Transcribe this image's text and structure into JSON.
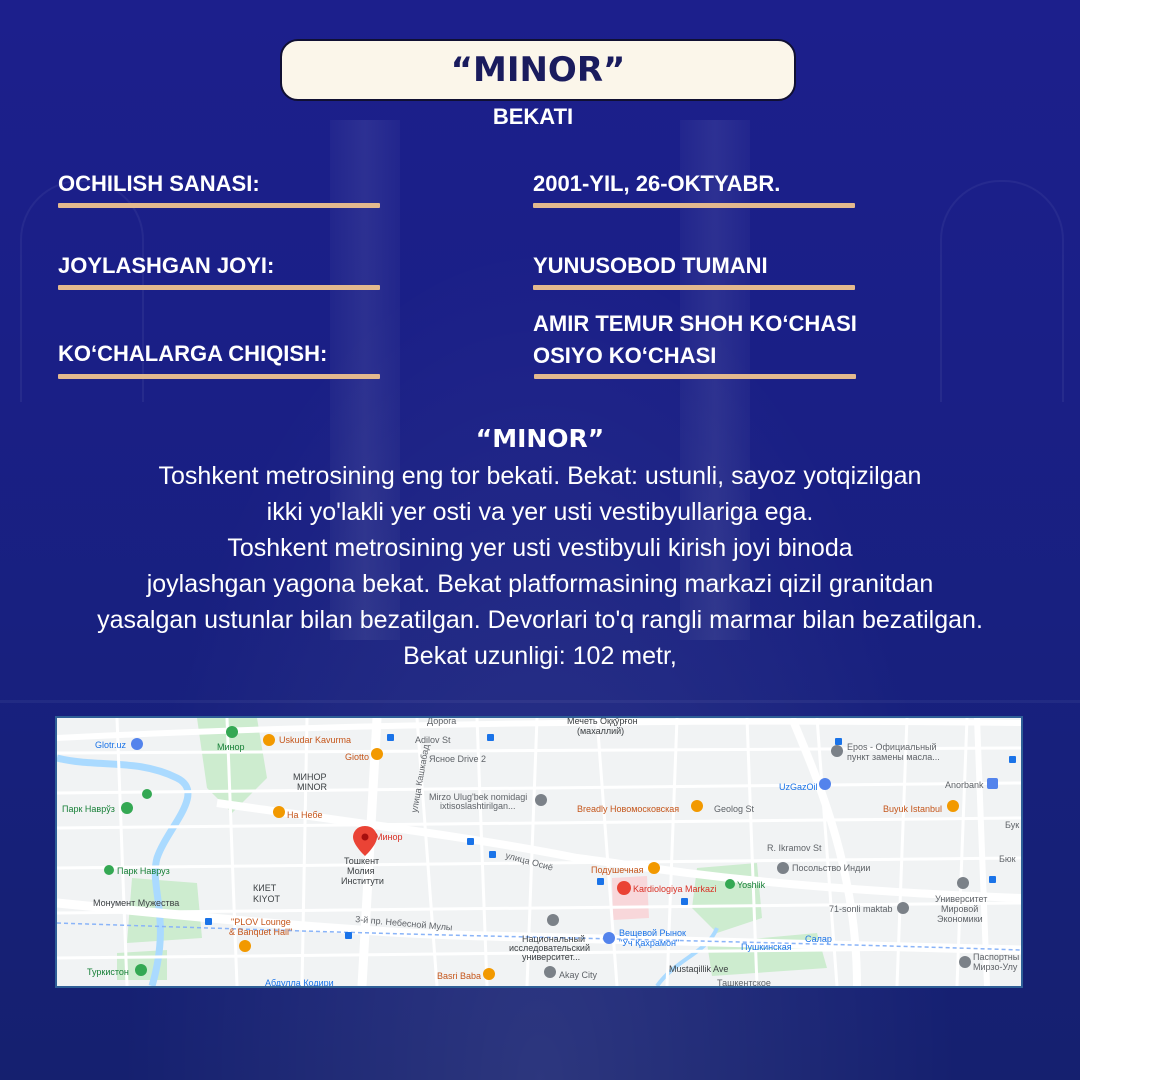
{
  "title": "“MINOR”",
  "subtitle": "BEKATI",
  "info": [
    {
      "label": "OCHILISH SANASI:",
      "value_lines": [
        "2001-YIL, 26-OKTYABR."
      ]
    },
    {
      "label": "JOYLASHGAN JOYI:",
      "value_lines": [
        "YUNUSOBOD TUMANI"
      ]
    },
    {
      "label": "KO‘CHALARGA CHIQISH:",
      "value_lines": [
        "AMIR TEMUR SHOH KO‘CHASI",
        "OSIYO KO‘CHASI"
      ]
    }
  ],
  "description": {
    "title": "“MINOR”",
    "lines": [
      "Toshkent metrosining eng tor bekati. Bekat: ustunli,  sayoz yotqizilgan",
      "ikki yo'lakli yer osti va yer usti vestibyullariga ega.",
      "Toshkent metrosining yer usti vestibyuli  kirish joyi binoda",
      "joylashgan yagona bekat. Bekat platformasining markazi qizil granitdan",
      "yasalgan ustunlar bilan bezatilgan. Devorlari to'q rangli marmar bilan bezatilgan.",
      "Bekat uzunligi: 102 metr,"
    ]
  },
  "map": {
    "pin_label": "Минор",
    "labels": {
      "doroga": "Дорога",
      "mosque": "Мечеть Оққўрғон",
      "mahalla": "(махаллий)",
      "glotr": "Glotr.uz",
      "minor_park": "Минор",
      "uskudar": "Uskudar Kavurma",
      "adilov": "Adilov St",
      "giotto": "Giotto",
      "yasnoe": "Ясное Drive 2",
      "minor_area1": "МИНОР",
      "minor_area2": "MINOR",
      "park_navruz1": "Парк Наврўз",
      "mirzo1": "Mirzo Ulug'bek nomidagi",
      "mirzo2": "ixtisoslashtirilgan...",
      "breadly": "Breadly Новомосковская",
      "geolog": "Geolog St",
      "uzgazoil": "UzGazOil",
      "epos1": "Epos - Официальный",
      "epos2": "пункт замены масла...",
      "anorbank": "Anorbank",
      "buyuk": "Buyuk Istanbul",
      "bukharskaya": "Бухарская",
      "na_nebe": "На Небе",
      "kashkabad": "улица Кашкабад",
      "ulitsa_osiyo": "улица Осиё",
      "tashkent_inst1": "Тошкент",
      "tashkent_inst2": "Молия",
      "tashkent_inst3": "Институти",
      "ikramov": "R. Ikramov St",
      "posolstvo": "Посольство Индии",
      "park_navruz2": "Парк Навруз",
      "kiyet1": "КИЕТ",
      "kiyet2": "KIYOT",
      "podushechnaya": "Подушечная",
      "kardiologiya": "Kardiologiya Markazi",
      "yoshlik": "Yoshlik",
      "universitet1": "Университет",
      "universitet2": "Мировой",
      "universitet3": "Экономики",
      "monument": "Монумент Мужества",
      "plov1": "\"PLOV Lounge",
      "plov2": "& Banquet Hall\"",
      "third_lane": "3-й пр. Небесной Мулы",
      "natsionalny1": "Национальный",
      "natsionalny2": "исследовательский",
      "natsionalny3": "университет...",
      "veshevoy1": "Вещевой Рынок",
      "veshevoy2": "\"Уч Қахрамон\"",
      "maktab71": "71-sonli maktab",
      "salar": "Салар",
      "pushkinskaya": "Пушкинская",
      "turkiston": "Туркистон",
      "basri": "Basri Baba",
      "akay": "Akay City",
      "mustaqillik": "Mustaqillik Ave",
      "pasport1": "Паспортны",
      "pasport2": "Мирзо-Улу",
      "abdulla": "Абдулла Кодири",
      "tashkentskoe": "Ташкентское",
      "buyuk_top": "Бук",
      "buyuk_mid": "Бюк"
    }
  },
  "colors": {
    "background": "#1a1f86",
    "title_box": "#fbf6ea",
    "title_text": "#1a1c5e",
    "underline": "#e3b98e",
    "map_border": "#2f5f97",
    "pin": "#ea4335"
  }
}
